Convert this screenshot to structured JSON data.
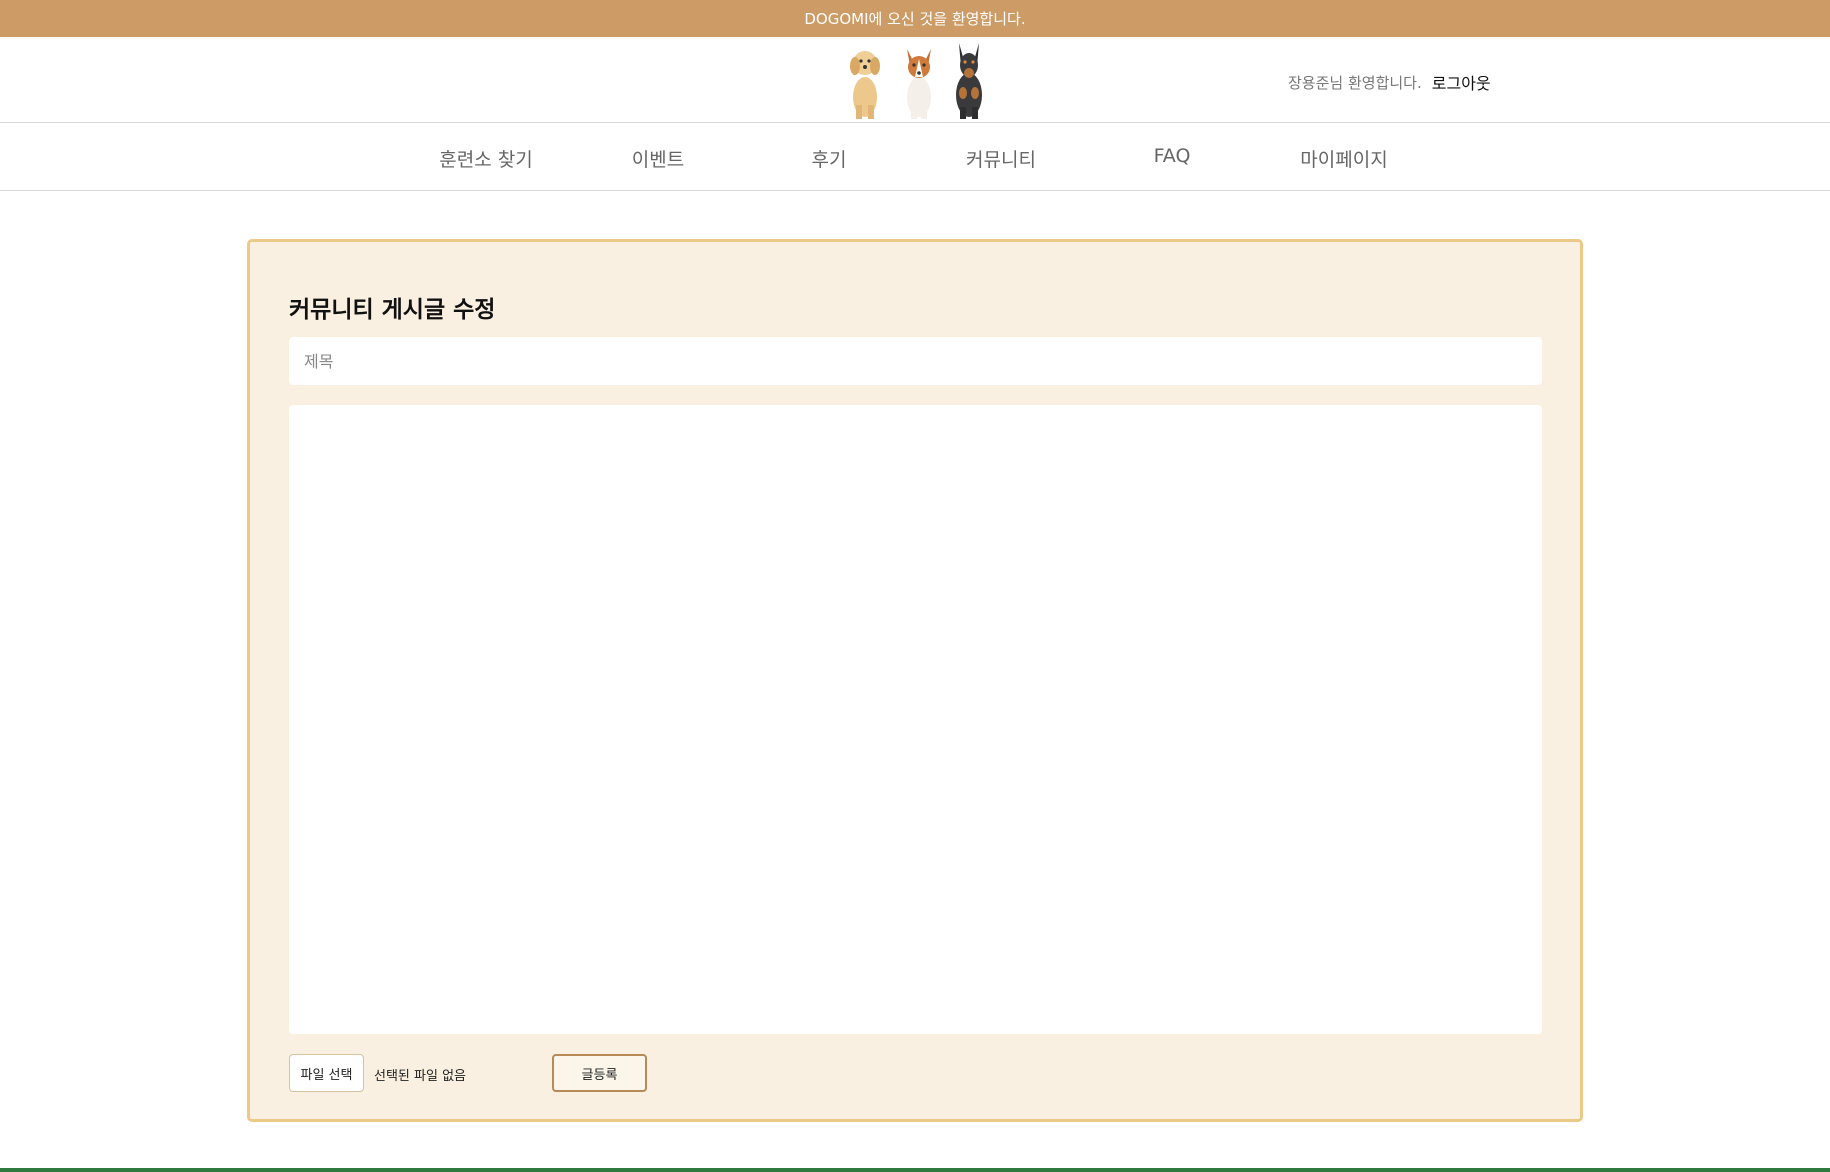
{
  "banner": {
    "text": "DOGOMI에 오신 것을 환영합니다."
  },
  "header": {
    "logo_icon": "three-dogs-logo",
    "welcome_text": "장용준님 환영합니다.",
    "logout_label": "로그아웃"
  },
  "nav": {
    "items": [
      {
        "label": "훈련소 찾기"
      },
      {
        "label": "이벤트"
      },
      {
        "label": "후기"
      },
      {
        "label": "커뮤니티"
      },
      {
        "label": "FAQ"
      },
      {
        "label": "마이페이지"
      }
    ]
  },
  "editor": {
    "heading": "커뮤니티 게시글 수정",
    "title_placeholder": "제목",
    "title_value": "",
    "content_value": "",
    "file_button_label": "파일 선택",
    "file_status": "선택된 파일 없음",
    "submit_label": "글등록"
  },
  "colors": {
    "banner": "#cd9c66",
    "card_background": "#f9f0e1",
    "card_border": "#edc987",
    "footer_line": "#2f7a3e"
  }
}
